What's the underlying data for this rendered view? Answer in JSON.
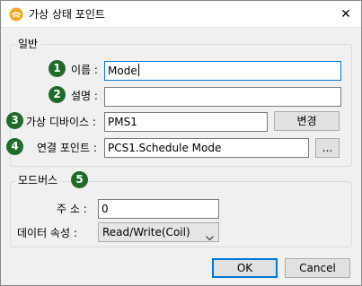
{
  "window": {
    "title": "가상 상태 포인트",
    "close_glyph": "✕"
  },
  "general": {
    "group_title": "일반",
    "name": {
      "badge": "1",
      "label": "이름 :",
      "value": "Mode"
    },
    "description": {
      "badge": "2",
      "label": "설명 :",
      "value": ""
    },
    "virtual_device": {
      "badge": "3",
      "label": "가상 디바이스 :",
      "value": "PMS1",
      "change_button": "변경"
    },
    "linked_point": {
      "badge": "4",
      "label": "연결 포인트 :",
      "value": "PCS1.Schedule Mode",
      "browse_button": "..."
    }
  },
  "modbus": {
    "group_title": "모드버스",
    "badge": "5",
    "address": {
      "label": "주 소 :",
      "value": "0"
    },
    "data_type": {
      "label": "데이터 속성 :",
      "selected": "Read/Write(Coil)"
    }
  },
  "buttons": {
    "ok": "OK",
    "cancel": "Cancel"
  },
  "colors": {
    "badge": "#1e6b2a",
    "accent": "#0078d7",
    "app_icon": "#f5a623"
  }
}
